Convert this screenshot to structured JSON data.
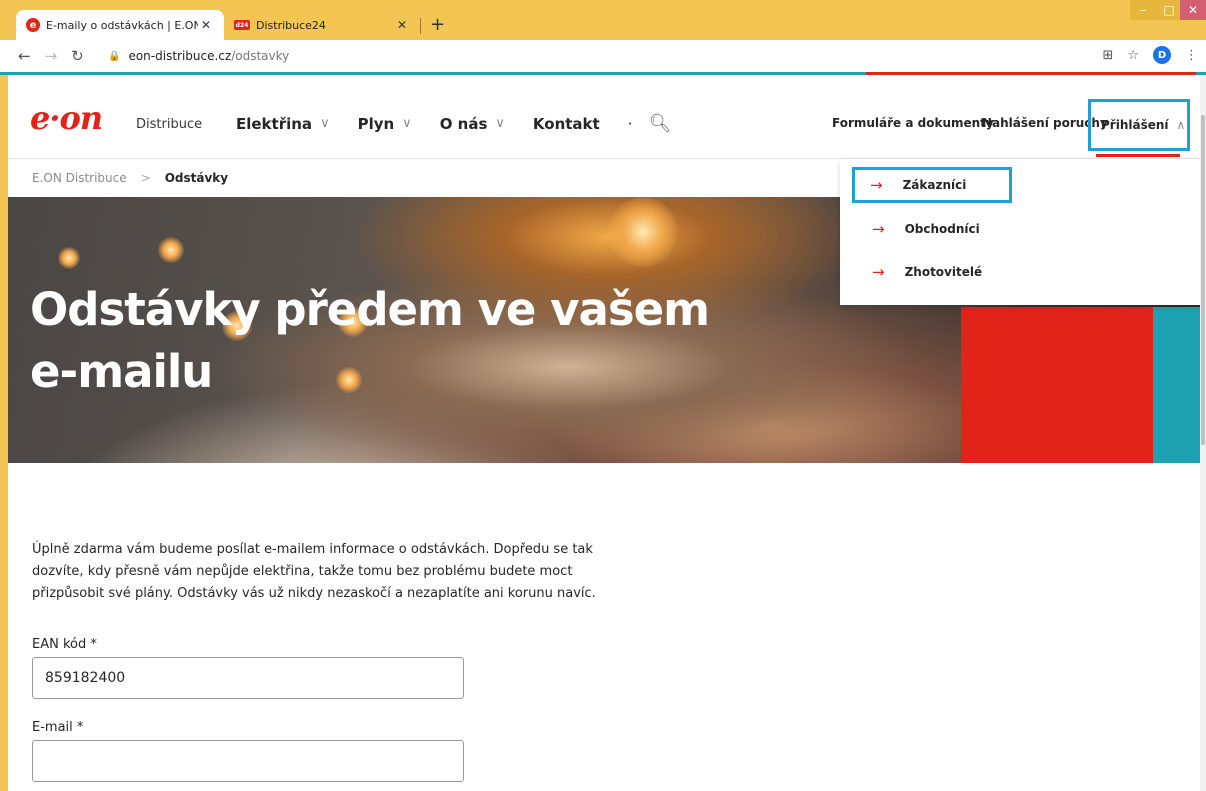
{
  "browser": {
    "tabs": [
      {
        "title": "E-maily o odstávkách | E.ON Distr",
        "active": true,
        "favicon": "e"
      },
      {
        "title": "Distribuce24",
        "active": false,
        "favicon": "d24"
      }
    ],
    "new_tab": "+",
    "url_host": "eon-distribuce.cz",
    "url_path": "/odstavky",
    "profile_initial": "D"
  },
  "header": {
    "logo": "e·on",
    "logo_sub": "Distribuce",
    "nav": [
      {
        "label": "Elektřina"
      },
      {
        "label": "Plyn"
      },
      {
        "label": "O nás"
      },
      {
        "label": "Kontakt"
      }
    ],
    "forms_link": "Formuláře a dokumenty",
    "outage_link": "Nahlášení poruchy",
    "login": "Přihlášení"
  },
  "breadcrumb": {
    "home": "E.ON Distribuce",
    "current": "Odstávky"
  },
  "dropdown": {
    "items": [
      "Zákazníci",
      "Obchodníci",
      "Zhotovitelé"
    ]
  },
  "hero": {
    "title": "Odstávky předem ve vašem e-mailu"
  },
  "content": {
    "intro": "Úplně zdarma vám budeme posílat e-mailem informace o odstávkách. Dopředu se tak dozvíte, kdy přesně vám nepůjde elektřina, takže tomu bez problému budete moct přizpůsobit své plány. Odstávky vás už nikdy nezaskočí a nezaplatíte ani korunu navíc.",
    "ean_label": "EAN kód *",
    "ean_value": "859182400",
    "email_label": "E-mail *",
    "email_value": ""
  },
  "colors": {
    "brand_red": "#e2231a",
    "teal": "#1ea2b1",
    "highlight_blue": "#1fa0d9",
    "chrome_yellow": "#f3c654"
  }
}
